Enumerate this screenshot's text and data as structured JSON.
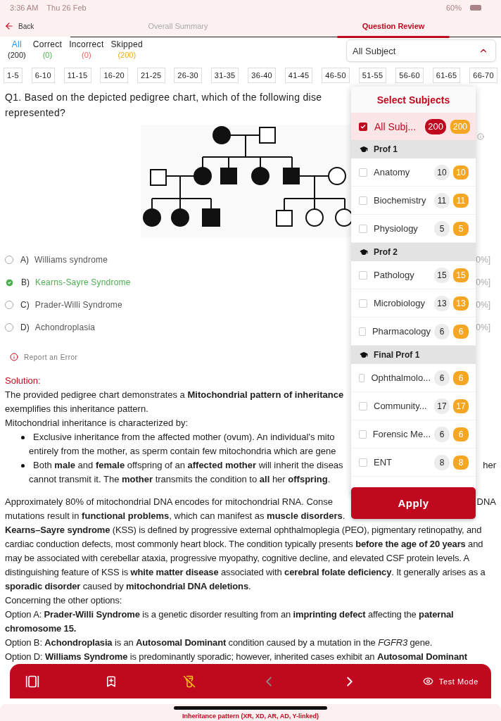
{
  "status_bar": {
    "time": "3:36 AM",
    "date": "Thu 26 Feb",
    "battery_text": "60%"
  },
  "header": {
    "back": "Back",
    "tabs": [
      {
        "label": "Overall Summary",
        "selected": false
      },
      {
        "label": "Question Review",
        "selected": true
      }
    ]
  },
  "filters": [
    {
      "kind": "all",
      "label": "All",
      "count": "(200)",
      "selected": true
    },
    {
      "kind": "correct",
      "label": "Correct",
      "count": "(0)",
      "selected": false
    },
    {
      "kind": "incorrect",
      "label": "Incorrect",
      "count": "(0)",
      "selected": false
    },
    {
      "kind": "skipped",
      "label": "Skipped",
      "count": "(200)",
      "selected": false
    }
  ],
  "subject_select": {
    "value": "All Subject",
    "expanded": true
  },
  "pages": [
    "1-5",
    "6-10",
    "11-15",
    "16-20",
    "21-25",
    "26-30",
    "31-35",
    "36-40",
    "41-45",
    "46-50",
    "51-55",
    "56-60",
    "61-65",
    "66-70"
  ],
  "question": {
    "lines": [
      "Q1. Based on the depicted pedigree chart, which of the following dise",
      "represented?"
    ],
    "options": [
      {
        "letter": "A)",
        "text": "Williams syndrome",
        "correct": false,
        "tail": "0%]"
      },
      {
        "letter": "B)",
        "text": "Kearns-Sayre Syndrome",
        "correct": true,
        "tail": "0%]"
      },
      {
        "letter": "C)",
        "text": "Prader-Willi Syndrome",
        "correct": false,
        "tail": "0%]"
      },
      {
        "letter": "D)",
        "text": "Achondroplasia",
        "correct": false,
        "tail": "0%]"
      }
    ],
    "report": "Report an Error"
  },
  "solution": {
    "heading": "Solution:",
    "lines": [
      {
        "kind": "line",
        "text": "The provided pedigree chart demonstrates a **Mitochondrial pattern of inheritance**"
      },
      {
        "kind": "line",
        "text": "exemplifies this inheritance pattern."
      },
      {
        "kind": "line",
        "text": "Mitochondrial inheritance is characterized by:"
      },
      {
        "kind": "bullet",
        "text": "Exclusive inheritance from the affected mother (ovum). An individual's mito"
      },
      {
        "kind": "indent",
        "text": "entirely from the mother, as sperm contain few mitochondria which are gene"
      },
      {
        "kind": "bullet",
        "text": "Both **male** and **female** offspring of an **affected mother** will inherit the diseas",
        "tail": "her"
      },
      {
        "kind": "indent",
        "text": "cannot transmit it. The **mother** transmits the condition to **all** her **offspring**."
      },
      {
        "kind": "gap",
        "text": "Approximately 80% of mitochondrial DNA encodes for mitochondrial RNA. Conse",
        "tail": "DNA"
      },
      {
        "kind": "line",
        "text": "mutations result in **functional problems**, which can manifest as **muscle disorders**."
      }
    ],
    "paragraphs": [
      "**Kearns–Sayre syndrome** (KSS) is defined by progressive external ophthalmoplegia (PEO), pigmentary retinopathy, and cardiac conduction defects, most commonly heart block. The condition typically presents **before the age of 20 years** and may be associated with cerebellar ataxia, progressive myopathy, cognitive decline, and elevated CSF protein levels. A distinguishing feature of KSS is **white matter disease** associated with **cerebral folate deficiency**. It generally arises as a **sporadic disorder** caused by **mitochondrial DNA deletions**.",
      "Concerning the other options:",
      "Option A: **Prader-Willi Syndrome** is a genetic disorder resulting from an **imprinting defect** affecting the **paternal chromosome 15.**",
      "Option B: **Achondroplasia** is an **Autosomal Dominant** condition caused by a mutation in the *FGFR3* gene.",
      "Option D: **Williams Syndrome** is predominantly sporadic; however, inherited cases exhibit an **Autosomal Dominant**"
    ]
  },
  "subject_panel": {
    "title": "Select Subjects",
    "all": {
      "label": "All Subj...",
      "checked": true,
      "count": "200",
      "count2": "200"
    },
    "groups": [
      {
        "name": "Prof 1",
        "items": [
          {
            "label": "Anatomy",
            "checked": false,
            "count": "10",
            "count2": "10"
          },
          {
            "label": "Biochemistry",
            "checked": false,
            "count": "11",
            "count2": "11"
          },
          {
            "label": "Physiology",
            "checked": false,
            "count": "5",
            "count2": "5"
          }
        ]
      },
      {
        "name": "Prof 2",
        "items": [
          {
            "label": "Pathology",
            "checked": false,
            "count": "15",
            "count2": "15"
          },
          {
            "label": "Microbiology",
            "checked": false,
            "count": "13",
            "count2": "13"
          },
          {
            "label": "Pharmacology",
            "checked": false,
            "count": "6",
            "count2": "6"
          }
        ]
      },
      {
        "name": "Final Prof 1",
        "items": [
          {
            "label": "Ophthalmolo...",
            "checked": false,
            "count": "6",
            "count2": "6"
          },
          {
            "label": "Community...",
            "checked": false,
            "count": "17",
            "count2": "17"
          },
          {
            "label": "Forensic Me...",
            "checked": false,
            "count": "6",
            "count2": "6"
          },
          {
            "label": "ENT",
            "checked": false,
            "count": "8",
            "count2": "8"
          }
        ]
      }
    ],
    "apply": "Apply"
  },
  "toolbar": {
    "prev_disabled": true,
    "next_disabled": false,
    "mode": "Test Mode"
  },
  "footer_text": "Inheritance pattern (XR, XD, AR, AD, Y-linked)"
}
